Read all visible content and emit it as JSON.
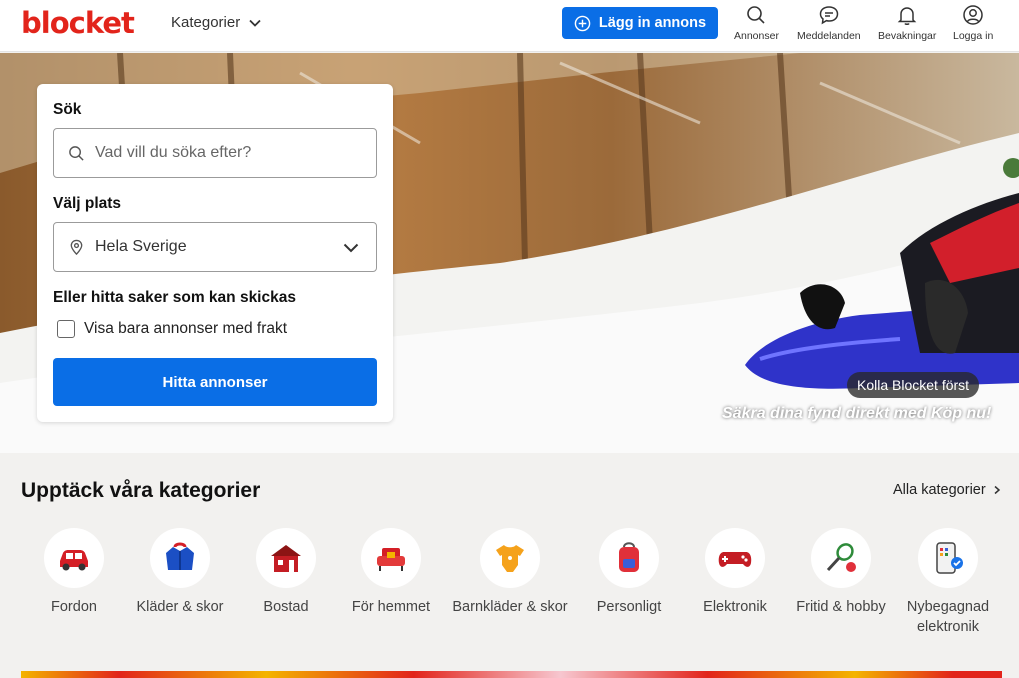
{
  "header": {
    "logo": "blocket",
    "categories_label": "Kategorier",
    "post_ad_label": "Lägg in annons",
    "nav": [
      {
        "label": "Annonser",
        "icon": "search-icon"
      },
      {
        "label": "Meddelanden",
        "icon": "chat-icon"
      },
      {
        "label": "Bevakningar",
        "icon": "bell-icon"
      },
      {
        "label": "Logga in",
        "icon": "user-icon"
      }
    ]
  },
  "search": {
    "search_label": "Sök",
    "search_placeholder": "Vad vill du söka efter?",
    "location_label": "Välj plats",
    "location_value": "Hela Sverige",
    "shipping_label": "Eller hitta saker som kan skickas",
    "shipping_checkbox_label": "Visa bara annonser med frakt",
    "shipping_checked": false,
    "submit_label": "Hitta annonser"
  },
  "promo": {
    "badge": "Kolla Blocket först",
    "text": "Säkra dina fynd direkt med Köp nu!"
  },
  "categories": {
    "heading": "Upptäck våra kategorier",
    "all_label": "Alla kategorier",
    "items": [
      {
        "label": "Fordon",
        "icon": "car-icon"
      },
      {
        "label": "Kläder & skor",
        "icon": "jacket-icon"
      },
      {
        "label": "Bostad",
        "icon": "house-icon"
      },
      {
        "label": "För hemmet",
        "icon": "armchair-icon"
      },
      {
        "label": "Barnkläder & skor",
        "icon": "baby-onesie-icon"
      },
      {
        "label": "Personligt",
        "icon": "backpack-icon"
      },
      {
        "label": "Elektronik",
        "icon": "gamepad-icon"
      },
      {
        "label": "Fritid & hobby",
        "icon": "racket-ball-icon"
      },
      {
        "label": "Nybegagnad elektronik",
        "icon": "phone-badge-icon"
      }
    ]
  },
  "colors": {
    "brand_red": "#e2241b",
    "primary_blue": "#0a6ee6"
  }
}
